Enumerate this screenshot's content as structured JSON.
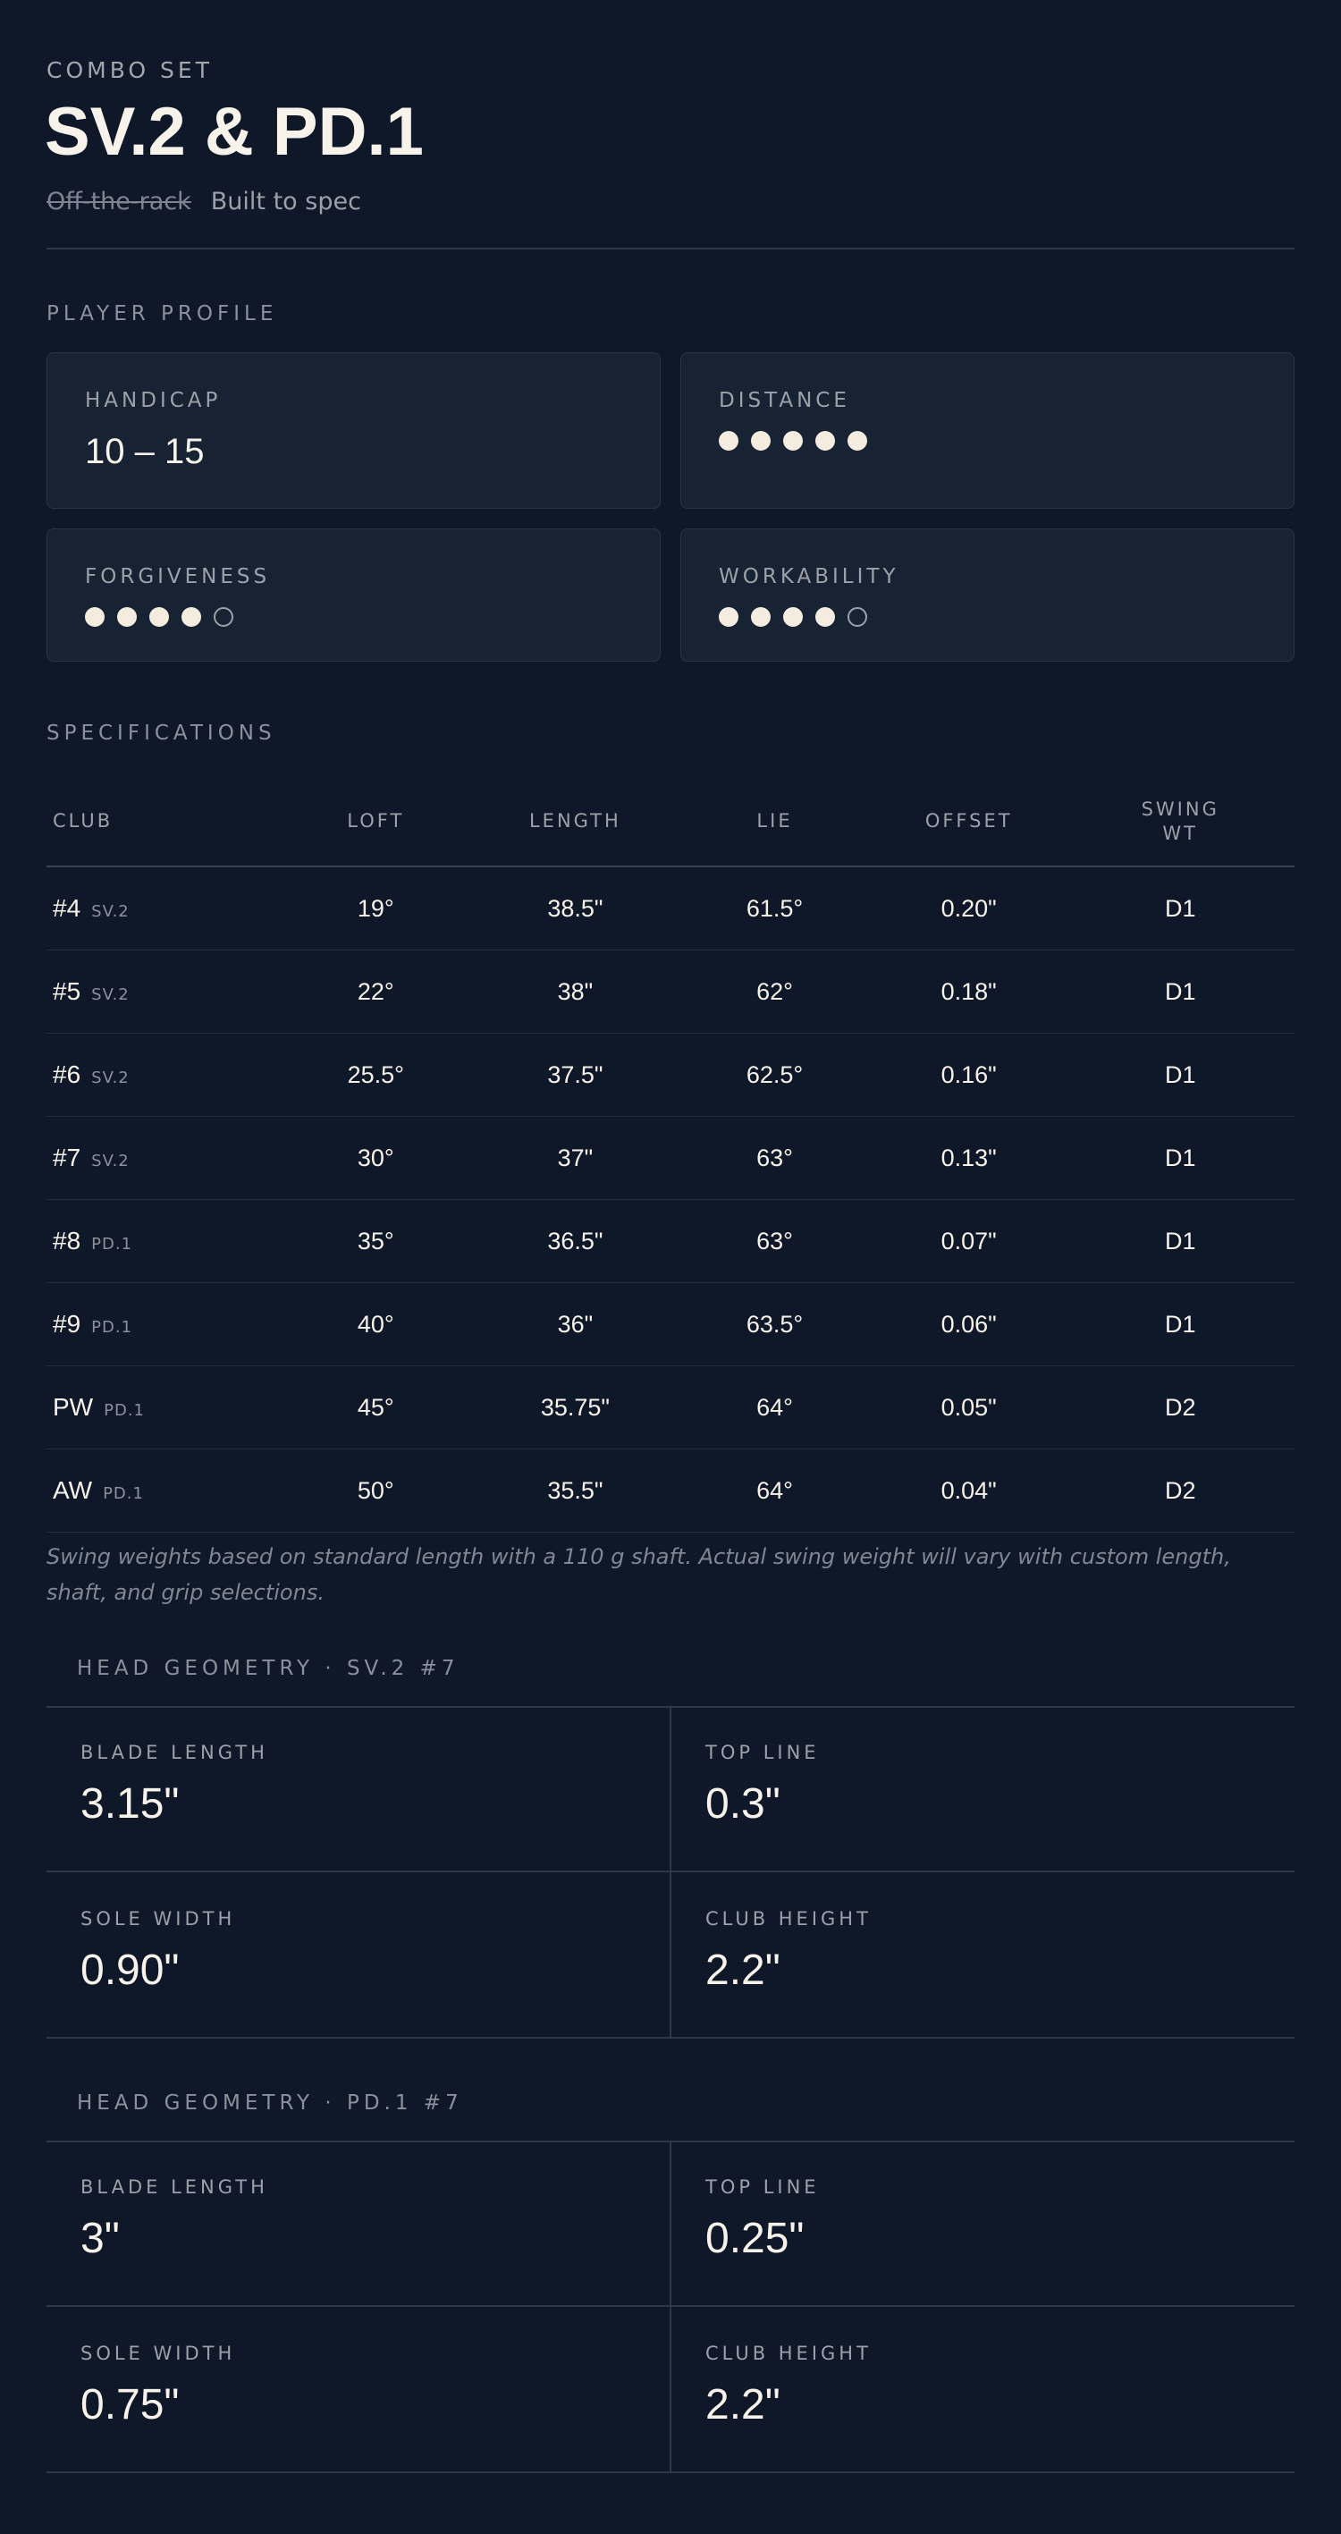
{
  "header": {
    "eyebrow": "COMBO SET",
    "title": "SV.2 & PD.1",
    "strike_text": "Off-the-rack",
    "subtitle": "Built to spec"
  },
  "profile": {
    "label": "PLAYER PROFILE",
    "handicap": {
      "label": "HANDICAP",
      "value": "10 – 15"
    },
    "distance": {
      "label": "DISTANCE",
      "rating": 5,
      "max": 5
    },
    "forgiveness": {
      "label": "FORGIVENESS",
      "rating": 4,
      "max": 5
    },
    "workability": {
      "label": "WORKABILITY",
      "rating": 4,
      "max": 5
    }
  },
  "specs": {
    "label": "SPECIFICATIONS",
    "columns": {
      "club": "CLUB",
      "loft": "LOFT",
      "length": "LENGTH",
      "lie": "LIE",
      "offset": "OFFSET",
      "swing_1": "SWING",
      "swing_2": "WT"
    },
    "rows": [
      {
        "club": "#4",
        "model": "SV.2",
        "loft": "19°",
        "length": "38.5\"",
        "lie": "61.5°",
        "offset": "0.20\"",
        "swing": "D1"
      },
      {
        "club": "#5",
        "model": "SV.2",
        "loft": "22°",
        "length": "38\"",
        "lie": "62°",
        "offset": "0.18\"",
        "swing": "D1"
      },
      {
        "club": "#6",
        "model": "SV.2",
        "loft": "25.5°",
        "length": "37.5\"",
        "lie": "62.5°",
        "offset": "0.16\"",
        "swing": "D1"
      },
      {
        "club": "#7",
        "model": "SV.2",
        "loft": "30°",
        "length": "37\"",
        "lie": "63°",
        "offset": "0.13\"",
        "swing": "D1"
      },
      {
        "club": "#8",
        "model": "PD.1",
        "loft": "35°",
        "length": "36.5\"",
        "lie": "63°",
        "offset": "0.07\"",
        "swing": "D1"
      },
      {
        "club": "#9",
        "model": "PD.1",
        "loft": "40°",
        "length": "36\"",
        "lie": "63.5°",
        "offset": "0.06\"",
        "swing": "D1"
      },
      {
        "club": "PW",
        "model": "PD.1",
        "loft": "45°",
        "length": "35.75\"",
        "lie": "64°",
        "offset": "0.05\"",
        "swing": "D2"
      },
      {
        "club": "AW",
        "model": "PD.1",
        "loft": "50°",
        "length": "35.5\"",
        "lie": "64°",
        "offset": "0.04\"",
        "swing": "D2"
      }
    ],
    "note": "Swing weights based on standard length with a 110 g shaft. Actual swing weight will vary with custom length, shaft, and grip selections."
  },
  "geometry_sv2": {
    "label": "HEAD GEOMETRY · SV.2 #7",
    "blade_length": {
      "label": "BLADE LENGTH",
      "value": "3.15\""
    },
    "top_line": {
      "label": "TOP LINE",
      "value": "0.3\""
    },
    "sole_width": {
      "label": "SOLE WIDTH",
      "value": "0.90\""
    },
    "club_height": {
      "label": "CLUB HEIGHT",
      "value": "2.2\""
    }
  },
  "geometry_pd1": {
    "label": "HEAD GEOMETRY · PD.1 #7",
    "blade_length": {
      "label": "BLADE LENGTH",
      "value": "3\""
    },
    "top_line": {
      "label": "TOP LINE",
      "value": "0.25\""
    },
    "sole_width": {
      "label": "SOLE WIDTH",
      "value": "0.75\""
    },
    "club_height": {
      "label": "CLUB HEIGHT",
      "value": "2.2\""
    }
  },
  "colors": {
    "background": "#0f1829",
    "card": "#172233",
    "text": "#f7f3ea",
    "muted": "#9ca1a9"
  }
}
